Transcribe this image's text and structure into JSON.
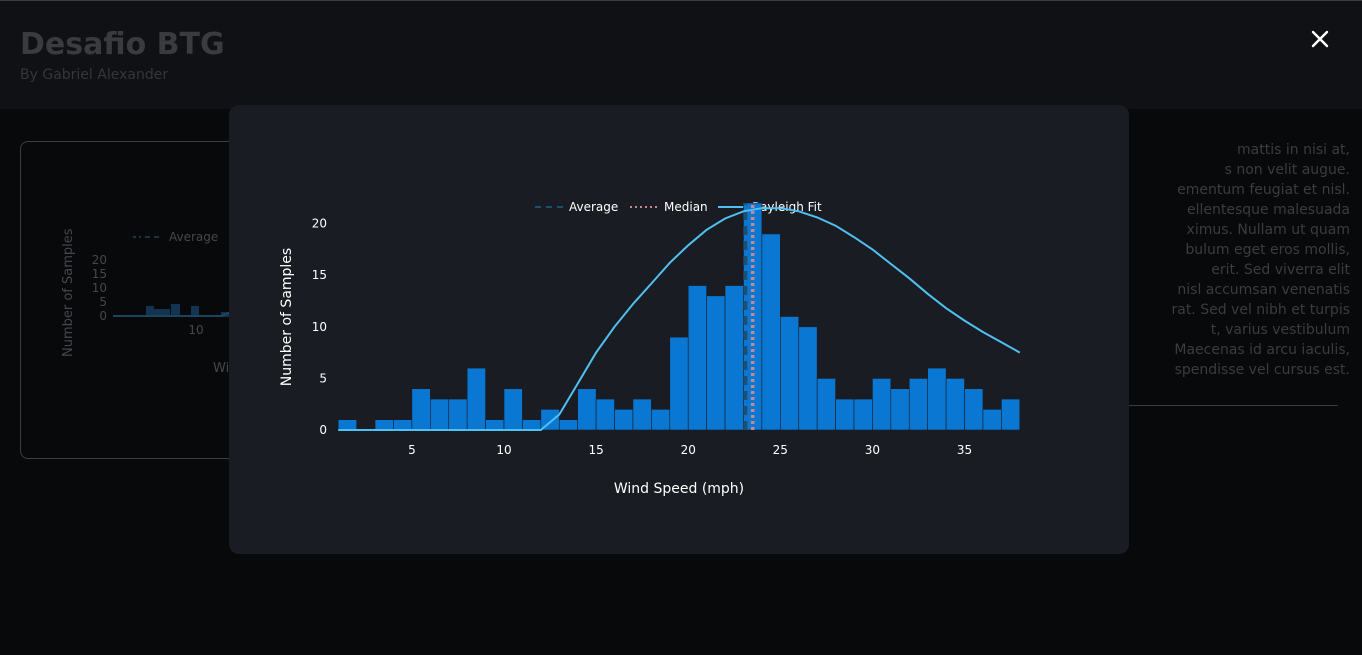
{
  "header": {
    "title": "Desafio BTG",
    "subtitle": "By Gabriel Alexander",
    "close_icon": "close-icon"
  },
  "background": {
    "card_chart": {
      "legend_average": "Average",
      "ylabel": "Number of Samples",
      "yticks": [
        "20",
        "15",
        "10",
        "5",
        "0"
      ],
      "xtick": "10",
      "xlabel_fragment": "Wi"
    },
    "paragraph_lines": [
      "mattis in nisi at,",
      "s non velit augue.",
      "ementum feugiat et nisl.",
      "ellentesque malesuada",
      "ximus. Nullam ut quam",
      "bulum eget eros mollis,",
      "erit. Sed viverra elit",
      "nisl accumsan venenatis",
      "rat. Sed vel nibh et turpis",
      "t, varius vestibulum",
      "Maecenas id arcu iaculis,",
      "spendisse vel cursus est."
    ]
  },
  "modal": {
    "chart_data": {
      "type": "bar",
      "title": "",
      "xlabel": "Wind Speed (mph)",
      "ylabel": "Number of Samples",
      "xlim": [
        0.5,
        38.5
      ],
      "ylim": [
        0,
        22
      ],
      "xticks": [
        5,
        10,
        15,
        20,
        25,
        30,
        35
      ],
      "yticks": [
        0,
        5,
        10,
        15,
        20
      ],
      "grid": false,
      "legend_position": "top",
      "colors": {
        "bars": "#0a78d2",
        "bar_edge": "#1a1c24",
        "average": "#1f4f6e",
        "median": "#c6888e",
        "rayleigh": "#4fc1f0",
        "text": "#ffffff"
      },
      "histogram": {
        "bin_width": 1,
        "bin_starts": [
          1,
          2,
          3,
          4,
          5,
          6,
          7,
          8,
          9,
          10,
          11,
          12,
          13,
          14,
          15,
          16,
          17,
          18,
          19,
          20,
          21,
          22,
          23,
          24,
          25,
          26,
          27,
          28,
          29,
          30,
          31,
          32,
          33,
          34,
          35,
          36,
          37
        ],
        "counts": [
          1,
          0,
          1,
          1,
          4,
          3,
          3,
          6,
          1,
          4,
          1,
          2,
          1,
          4,
          3,
          2,
          3,
          2,
          9,
          14,
          13,
          14,
          22,
          19,
          11,
          10,
          5,
          3,
          3,
          5,
          4,
          5,
          6,
          5,
          4,
          2,
          3
        ]
      },
      "series": [
        {
          "name": "Average",
          "type": "vline",
          "style": "dashed",
          "x": 23.1
        },
        {
          "name": "Median",
          "type": "vline",
          "style": "dotted",
          "x": 23.5
        },
        {
          "name": "Rayleigh Fit",
          "type": "line",
          "x": [
            1,
            2,
            3,
            4,
            5,
            6,
            7,
            8,
            9,
            10,
            11,
            12,
            13,
            14,
            15,
            16,
            17,
            18,
            19,
            20,
            21,
            22,
            23,
            24,
            25,
            26,
            27,
            28,
            29,
            30,
            31,
            32,
            33,
            34,
            35,
            36,
            37,
            38
          ],
          "y": [
            0,
            0,
            0,
            0,
            0,
            0,
            0,
            0,
            0,
            0,
            0,
            0,
            1.5,
            4.5,
            7.5,
            10.0,
            12.2,
            14.2,
            16.2,
            17.9,
            19.4,
            20.5,
            21.2,
            21.5,
            21.5,
            21.2,
            20.6,
            19.8,
            18.7,
            17.5,
            16.1,
            14.7,
            13.2,
            11.8,
            10.6,
            9.5,
            8.5,
            7.5
          ]
        }
      ]
    }
  }
}
